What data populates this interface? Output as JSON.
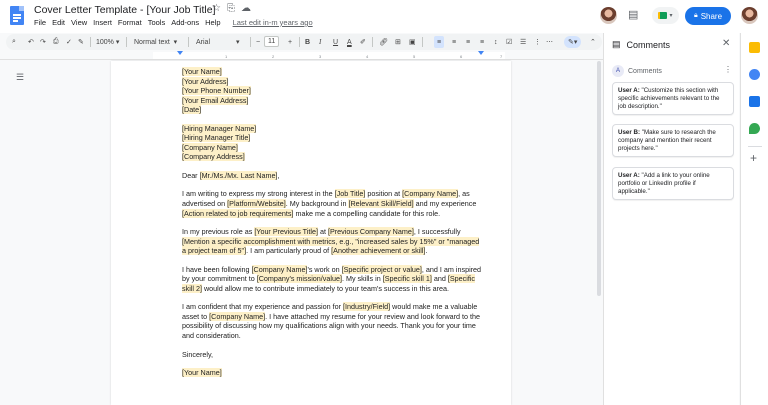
{
  "doc": {
    "title": "Cover Letter Template - [Your Job Title]",
    "last_edit": "Last edit in-m years ago",
    "menu": [
      "File",
      "Edit",
      "View",
      "Insert",
      "Format",
      "Tools",
      "Add-ons",
      "Help"
    ]
  },
  "header": {
    "share_label": "Share"
  },
  "toolbar": {
    "zoom": "100%",
    "style": "Normal text",
    "font": "Arial",
    "font_size": "11",
    "minus": "−",
    "plus": "+",
    "bold": "B",
    "italic": "I",
    "underline": "U",
    "text_color": "A"
  },
  "ruler": {
    "ticks": [
      "1",
      "2",
      "3",
      "4",
      "5",
      "6",
      "7"
    ]
  },
  "letter": {
    "addr": [
      "[Your Name]",
      "[Your Address]",
      "[Your Phone Number]",
      "[Your Email Address]",
      "[Date]"
    ],
    "recipient": [
      "[Hiring Manager Name]",
      "[Hiring Manager Title]",
      "[Company Name]",
      "[Company Address]"
    ],
    "salutation": {
      "pre": "Dear ",
      "hl": "[Mr./Ms./Mx. Last Name]",
      "post": ","
    },
    "p1": [
      {
        "t": "I am writing to express my strong interest in the "
      },
      {
        "t": "[Job Title]",
        "hl": true
      },
      {
        "t": " position at "
      },
      {
        "t": "[Company Name]",
        "hl": true
      },
      {
        "t": ", as advertised on "
      },
      {
        "t": "[Platform/Website]",
        "hl": true
      },
      {
        "t": ". My background in "
      },
      {
        "t": "[Relevant Skill/Field]",
        "hl": true
      },
      {
        "t": " and my experience "
      },
      {
        "t": "[Action related to job requirements]",
        "hl": true
      },
      {
        "t": " make me a compelling candidate for this role."
      }
    ],
    "p2": [
      {
        "t": "In my previous role as "
      },
      {
        "t": "[Your Previous Title]",
        "hl": true
      },
      {
        "t": " at "
      },
      {
        "t": "[Previous Company Name]",
        "hl": true
      },
      {
        "t": ", I successfully "
      },
      {
        "t": "[Mention a specific accomplishment with metrics, e.g., \"increased sales by 15%\" or \"managed a project team of 5\"]",
        "hl": true
      },
      {
        "t": ". I am particularly proud of "
      },
      {
        "t": "[Another achievement or skill]",
        "hl": true
      },
      {
        "t": "."
      }
    ],
    "p3": [
      {
        "t": "I have been following "
      },
      {
        "t": "[Company Name]",
        "hl": true
      },
      {
        "t": "'s work on "
      },
      {
        "t": "[Specific project or value]",
        "hl": true
      },
      {
        "t": ", and I am inspired by your commitment to "
      },
      {
        "t": "[Company's mission/value]",
        "hl": true
      },
      {
        "t": ". My skills in "
      },
      {
        "t": "[Specific skill 1]",
        "hl": true
      },
      {
        "t": " and "
      },
      {
        "t": "[Specific skill 2]",
        "hl": true
      },
      {
        "t": " would allow me to contribute immediately to your team's success in this area."
      }
    ],
    "p4": [
      {
        "t": "I am confident that my experience and passion for "
      },
      {
        "t": "[Industry/Field]",
        "hl": true
      },
      {
        "t": " would make me a valuable asset to "
      },
      {
        "t": "[Company Name]",
        "hl": true
      },
      {
        "t": ". I have attached my resume for your review and look forward to the possibility of discussing how my qualifications align with your needs. Thank you for your time and consideration."
      }
    ],
    "closing": "Sincerely,",
    "signature": "[Your Name]"
  },
  "comments": {
    "panel_title": "Comments",
    "filter_label": "Comments",
    "avatar_letter": "A",
    "items": [
      {
        "user": "User A:",
        "text": "\"Customize this section with specific achievements relevant to the job description.\""
      },
      {
        "user": "User B:",
        "text": "\"Make sure to research the company and mention their recent projects here.\""
      },
      {
        "user": "User A:",
        "text": "\"Add a link to your online portfolio or LinkedIn profile if applicable.\""
      }
    ]
  },
  "colors": {
    "accent": "#1a73e8",
    "highlight": "#fdf0c8",
    "docs_blue": "#4285f4"
  }
}
